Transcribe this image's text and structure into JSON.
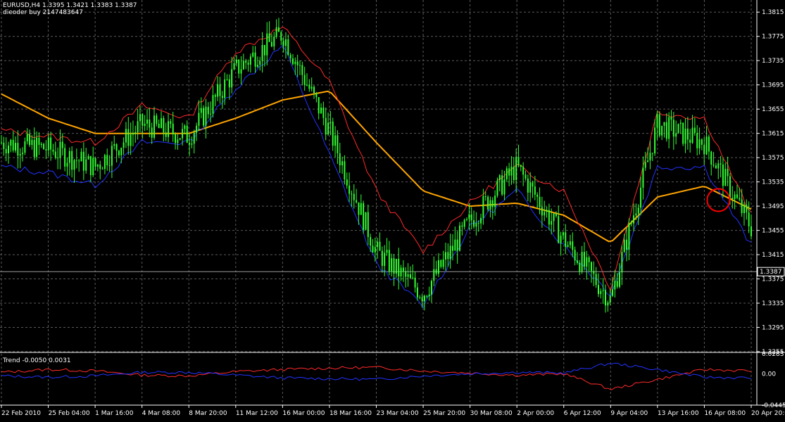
{
  "header": {
    "symbol_line": "EURUSD,H4  1.3395 1.3421 1.3383 1.3387",
    "ea_line": "dieoder buy 2147483647"
  },
  "indicator": {
    "label": "Trend -0.0050 0.0031"
  },
  "colors": {
    "background": "#000000",
    "grid": "#5a5a5a",
    "axis": "#ffffff",
    "candles": "#33ff33",
    "envelope_upper": "#ff2a2a",
    "envelope_lower": "#2233ff",
    "moving_average": "#ffa500",
    "marker_circle": "#ff0000",
    "indicator_up": "#ff2a2a",
    "indicator_down": "#2233ff"
  },
  "price_axis": {
    "ticks": [
      "1.3815",
      "1.3775",
      "1.3735",
      "1.3695",
      "1.3655",
      "1.3615",
      "1.3575",
      "1.3535",
      "1.3495",
      "1.3455",
      "1.3415",
      "1.3375",
      "1.3335",
      "1.3295",
      "1.3255"
    ],
    "current_price": "1.3387"
  },
  "indicator_axis": {
    "ticks": [
      "0.0283",
      "0.00",
      "-0.0445"
    ]
  },
  "time_axis": {
    "ticks": [
      "22 Feb 2010",
      "25 Feb 04:00",
      "1 Mar 16:00",
      "4 Mar 08:00",
      "8 Mar 20:00",
      "11 Mar 12:00",
      "16 Mar 00:00",
      "18 Mar 16:00",
      "23 Mar 04:00",
      "25 Mar 20:00",
      "30 Mar 08:00",
      "2 Apr 00:00",
      "6 Apr 12:00",
      "9 Apr 04:00",
      "13 Apr 16:00",
      "16 Apr 08:00",
      "20 Apr 20:00"
    ]
  },
  "chart_data": {
    "type": "line",
    "instrument": "EURUSD,H4",
    "ylim": [
      1.3255,
      1.3835
    ],
    "grid": true,
    "x": [
      "22 Feb 2010",
      "25 Feb 04:00",
      "1 Mar 16:00",
      "4 Mar 08:00",
      "8 Mar 20:00",
      "11 Mar 12:00",
      "16 Mar 00:00",
      "18 Mar 16:00",
      "23 Mar 04:00",
      "25 Mar 20:00",
      "30 Mar 08:00",
      "2 Apr 00:00",
      "6 Apr 12:00",
      "9 Apr 04:00",
      "13 Apr 16:00",
      "16 Apr 08:00",
      "20 Apr 20:00"
    ],
    "series": [
      {
        "values": [
          1.36,
          1.359,
          1.356,
          1.363,
          1.361,
          1.372,
          1.378,
          1.362,
          1.342,
          1.335,
          1.347,
          1.356,
          1.344,
          1.334,
          1.363,
          1.36,
          1.346
        ]
      }
    ],
    "envelope_upper": [
      1.362,
      1.361,
      1.36,
      1.366,
      1.364,
      1.375,
      1.379,
      1.37,
      1.352,
      1.342,
      1.35,
      1.356,
      1.352,
      1.336,
      1.365,
      1.364,
      1.348
    ],
    "envelope_lower": [
      1.356,
      1.355,
      1.353,
      1.36,
      1.36,
      1.369,
      1.376,
      1.358,
      1.34,
      1.333,
      1.346,
      1.352,
      1.343,
      1.335,
      1.356,
      1.356,
      1.343
    ],
    "moving_average": [
      1.368,
      1.364,
      1.3615,
      1.3615,
      1.3615,
      1.364,
      1.367,
      1.3685,
      1.36,
      1.352,
      1.3495,
      1.35,
      1.348,
      1.3435,
      1.351,
      1.3528,
      1.349
    ],
    "marker_circle": {
      "x": "16 Apr 08:00",
      "y": 1.3505
    },
    "indicator": {
      "ylim": [
        -0.0445,
        0.0283
      ],
      "up": [
        0.002,
        0.006,
        0.004,
        -0.002,
        -0.003,
        0.003,
        0.006,
        0.008,
        0.009,
        0.004,
        0.001,
        -0.002,
        0.0,
        -0.022,
        -0.008,
        0.006,
        0.004
      ],
      "down": [
        -0.003,
        -0.005,
        -0.003,
        0.002,
        0.002,
        -0.002,
        -0.006,
        -0.007,
        -0.008,
        -0.003,
        0.0,
        0.002,
        0.001,
        0.015,
        0.006,
        -0.005,
        -0.006
      ]
    }
  }
}
